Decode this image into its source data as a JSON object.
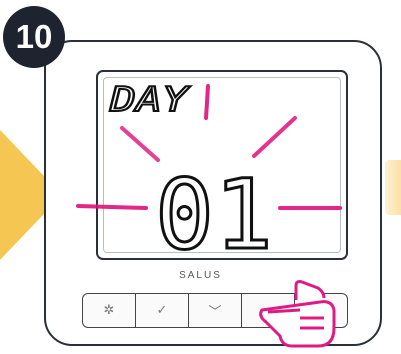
{
  "step": {
    "number": "10"
  },
  "lcd": {
    "label": "DAY",
    "value": "01"
  },
  "brand": {
    "logo_text": "SALUS"
  },
  "buttons": [
    {
      "icon": "gear-icon",
      "glyph": "✲"
    },
    {
      "icon": "checkmark-icon",
      "glyph": "✓"
    },
    {
      "icon": "chevron-down-icon",
      "glyph": "﹀"
    },
    {
      "icon": "chevron-up-icon",
      "glyph": "︿"
    },
    {
      "icon": "power-icon",
      "glyph": "⏻"
    }
  ],
  "colors": {
    "highlight": "#e0107a",
    "accent": "#f6c34a",
    "badge": "#1d2430",
    "hand": "#e01a84"
  }
}
